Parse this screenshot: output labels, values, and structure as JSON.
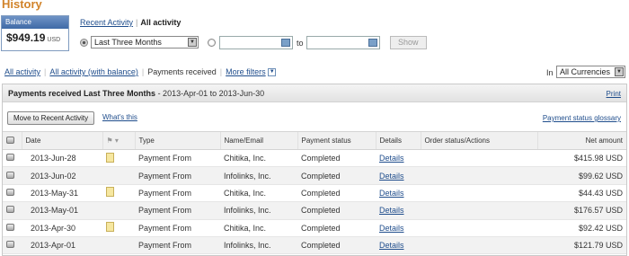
{
  "page": {
    "title": "History"
  },
  "balance": {
    "label": "Balance",
    "amount": "$949.19",
    "currency": "USD"
  },
  "views": {
    "recent": "Recent Activity",
    "separator": "|",
    "all": "All activity"
  },
  "range": {
    "preset": "Last Three Months",
    "to_label": "to",
    "show_label": "Show"
  },
  "filters": {
    "all_activity": "All activity",
    "all_with_balance": "All activity (with balance)",
    "payments_received": "Payments received",
    "more_filters": "More filters",
    "in_label": "In",
    "currency_select": "All Currencies"
  },
  "panel": {
    "title": "Payments received Last Three Months",
    "subtitle": " - 2013-Apr-01 to 2013-Jun-30",
    "print": "Print",
    "move_button": "Move to Recent Activity",
    "whats_this": "What's this",
    "glossary": "Payment status glossary"
  },
  "columns": [
    "Date",
    "Type",
    "Name/Email",
    "Payment status",
    "Details",
    "Order status/Actions",
    "Net amount"
  ],
  "rows": [
    {
      "date": "2013-Jun-28",
      "note": true,
      "type": "Payment From",
      "name": "Chitika, Inc.",
      "status": "Completed",
      "details": "Details",
      "amount": "$415.98 USD"
    },
    {
      "date": "2013-Jun-02",
      "note": false,
      "type": "Payment From",
      "name": "Infolinks, Inc.",
      "status": "Completed",
      "details": "Details",
      "amount": "$99.62 USD"
    },
    {
      "date": "2013-May-31",
      "note": true,
      "type": "Payment From",
      "name": "Chitika, Inc.",
      "status": "Completed",
      "details": "Details",
      "amount": "$44.43 USD"
    },
    {
      "date": "2013-May-01",
      "note": false,
      "type": "Payment From",
      "name": "Infolinks, Inc.",
      "status": "Completed",
      "details": "Details",
      "amount": "$176.57 USD"
    },
    {
      "date": "2013-Apr-30",
      "note": true,
      "type": "Payment From",
      "name": "Chitika, Inc.",
      "status": "Completed",
      "details": "Details",
      "amount": "$92.42 USD"
    },
    {
      "date": "2013-Apr-01",
      "note": false,
      "type": "Payment From",
      "name": "Infolinks, Inc.",
      "status": "Completed",
      "details": "Details",
      "amount": "$121.79 USD"
    }
  ],
  "icons": {
    "select_all": "checkbox-icon",
    "flag": "flag-icon",
    "note": "note-icon",
    "calendar": "calendar-icon"
  },
  "colors": {
    "title": "#d1832a",
    "link": "#1f4d8c",
    "balance_header": "#4f79b3"
  }
}
